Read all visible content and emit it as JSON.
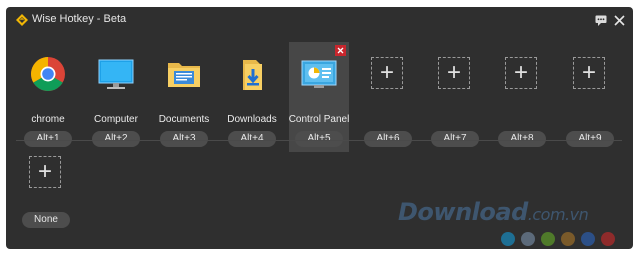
{
  "window": {
    "title": "Wise Hotkey - Beta"
  },
  "tiles_row1": [
    {
      "label": "chrome",
      "hotkey": "Alt+1"
    },
    {
      "label": "Computer",
      "hotkey": "Alt+2"
    },
    {
      "label": "Documents",
      "hotkey": "Alt+3"
    },
    {
      "label": "Downloads",
      "hotkey": "Alt+4"
    },
    {
      "label": "Control Panel",
      "hotkey": "Alt+5"
    },
    {
      "hotkey": "Alt+6"
    },
    {
      "hotkey": "Alt+7"
    },
    {
      "hotkey": "Alt+8"
    },
    {
      "hotkey": "Alt+9"
    }
  ],
  "tiles_row2": [
    {
      "hotkey": "None"
    }
  ],
  "plus_glyph": "+",
  "watermark": {
    "brand": "Download",
    "domain": ".com.vn"
  },
  "dot_colors": [
    "#1e6f94",
    "#5c6a7a",
    "#4f7a2a",
    "#7a5a2a",
    "#2c4f86",
    "#8e2b2b"
  ]
}
